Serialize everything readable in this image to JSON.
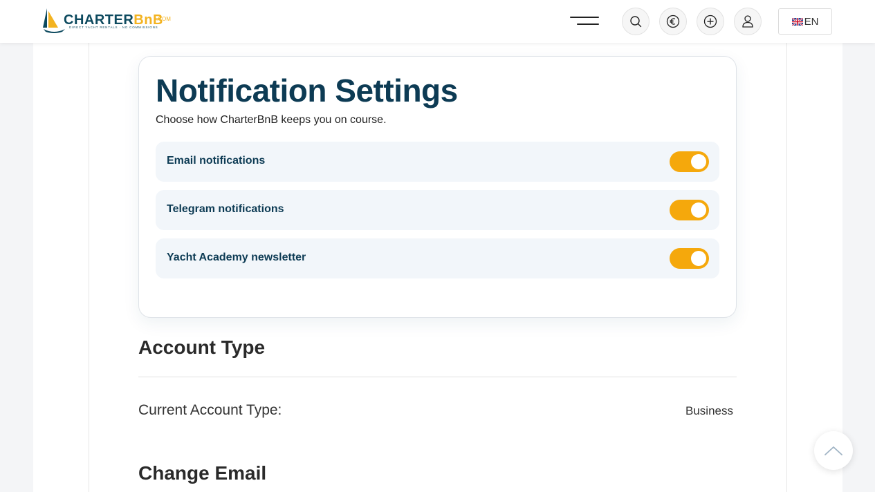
{
  "header": {
    "logo": {
      "name_main": "CHARTER",
      "name_accent": "BnB",
      "domain_suffix": ".COM",
      "tagline": "DIRECT YACHT RENTALS · NO COMMISSIONS"
    },
    "icons": {
      "menu": "hamburger-menu-icon",
      "search": "search-icon",
      "currency": "euro-icon",
      "add": "plus-circle-icon",
      "user": "user-icon",
      "flag": "uk-flag-icon"
    },
    "language_label": "EN"
  },
  "notifications": {
    "title": "Notification Settings",
    "subtitle": "Choose how CharterBnB keeps you on course.",
    "items": [
      {
        "label": "Email notifications",
        "enabled": true
      },
      {
        "label": "Telegram notifications",
        "enabled": true
      },
      {
        "label": "Yacht Academy newsletter",
        "enabled": true
      }
    ]
  },
  "account_type": {
    "title": "Account Type",
    "label": "Current Account Type:",
    "value": "Business"
  },
  "change_email": {
    "title": "Change Email"
  },
  "colors": {
    "brand_navy": "#0d3b54",
    "brand_yellow": "#f3b321",
    "toggle_on": "#f5a80c"
  }
}
